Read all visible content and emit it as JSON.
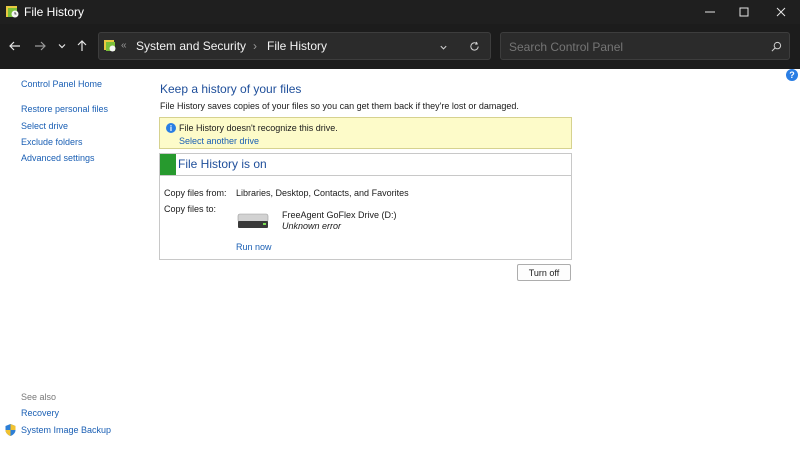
{
  "window": {
    "title": "File History"
  },
  "nav": {
    "back_icon": "arrow-left-icon",
    "forward_icon": "arrow-right-icon",
    "recent_icon": "chevron-down-icon",
    "up_icon": "arrow-up-icon",
    "address": {
      "separator": "«",
      "crumbs": [
        "System and Security",
        "File History"
      ],
      "arrow": "›"
    },
    "search": {
      "placeholder": "Search Control Panel"
    }
  },
  "sidebar": {
    "items": [
      "Control Panel Home",
      "Restore personal files",
      "Select drive",
      "Exclude folders",
      "Advanced settings"
    ],
    "see_also": "See also",
    "see_also_items": [
      "Recovery",
      "System Image Backup"
    ]
  },
  "main": {
    "heading": "Keep a history of your files",
    "description": "File History saves copies of your files so you can get them back if they're lost or damaged.",
    "warning": {
      "message": "File History doesn't recognize this drive.",
      "link": "Select another drive"
    },
    "status": {
      "title": "File History is on",
      "copy_from_label": "Copy files from:",
      "copy_from_value": "Libraries, Desktop, Contacts, and Favorites",
      "copy_to_label": "Copy files to:",
      "drive_name": "FreeAgent GoFlex Drive (D:)",
      "drive_status": "Unknown error",
      "run_now": "Run now"
    },
    "turn_off": "Turn off"
  },
  "help": "?",
  "colors": {
    "accent_link": "#1a5fb4",
    "heading": "#1e4e9a",
    "status_green": "#279a2e",
    "warning_bg": "#fdfbc9"
  }
}
